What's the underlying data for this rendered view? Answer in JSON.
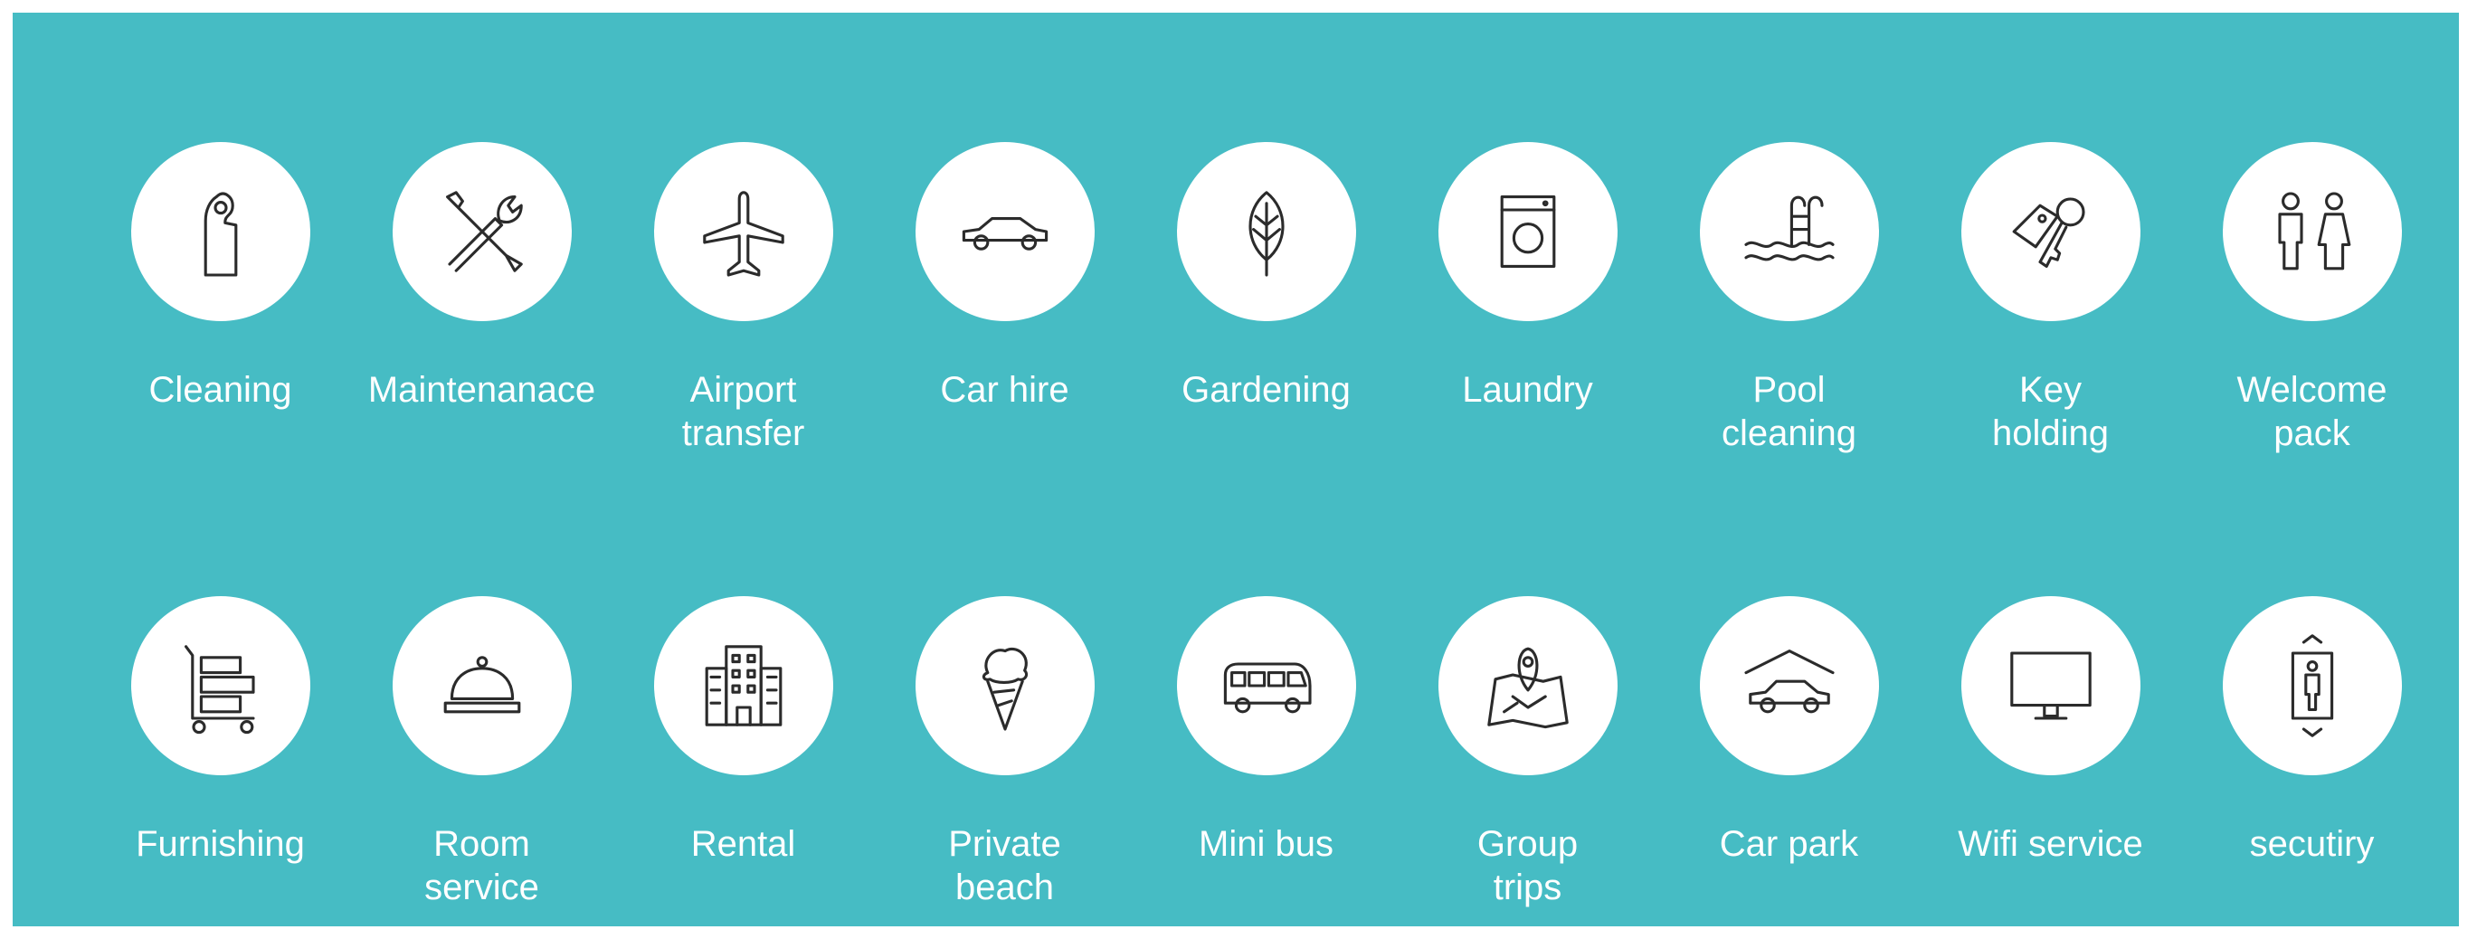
{
  "panel_color": "#46bcc4",
  "services_row1": [
    {
      "icon": "door-hanger-icon",
      "label": "Cleaning"
    },
    {
      "icon": "wrench-screwdriver-icon",
      "label": "Maintenanace"
    },
    {
      "icon": "airplane-icon",
      "label": "Airport\ntransfer"
    },
    {
      "icon": "car-icon",
      "label": "Car hire"
    },
    {
      "icon": "leaf-icon",
      "label": "Gardening"
    },
    {
      "icon": "washing-machine-icon",
      "label": "Laundry"
    },
    {
      "icon": "pool-ladder-icon",
      "label": "Pool\ncleaning"
    },
    {
      "icon": "key-tag-icon",
      "label": "Key\nholding"
    },
    {
      "icon": "people-icon",
      "label": "Welcome\npack"
    }
  ],
  "services_row2": [
    {
      "icon": "furniture-cart-icon",
      "label": "Furnishing"
    },
    {
      "icon": "service-bell-icon",
      "label": "Room\nservice"
    },
    {
      "icon": "building-icon",
      "label": "Rental"
    },
    {
      "icon": "ice-cream-icon",
      "label": "Private\nbeach"
    },
    {
      "icon": "minibus-icon",
      "label": "Mini bus"
    },
    {
      "icon": "map-pin-icon",
      "label": "Group\ntrips"
    },
    {
      "icon": "carport-icon",
      "label": "Car park"
    },
    {
      "icon": "monitor-icon",
      "label": "Wifi service"
    },
    {
      "icon": "elevator-icon",
      "label": "secutiry"
    }
  ]
}
